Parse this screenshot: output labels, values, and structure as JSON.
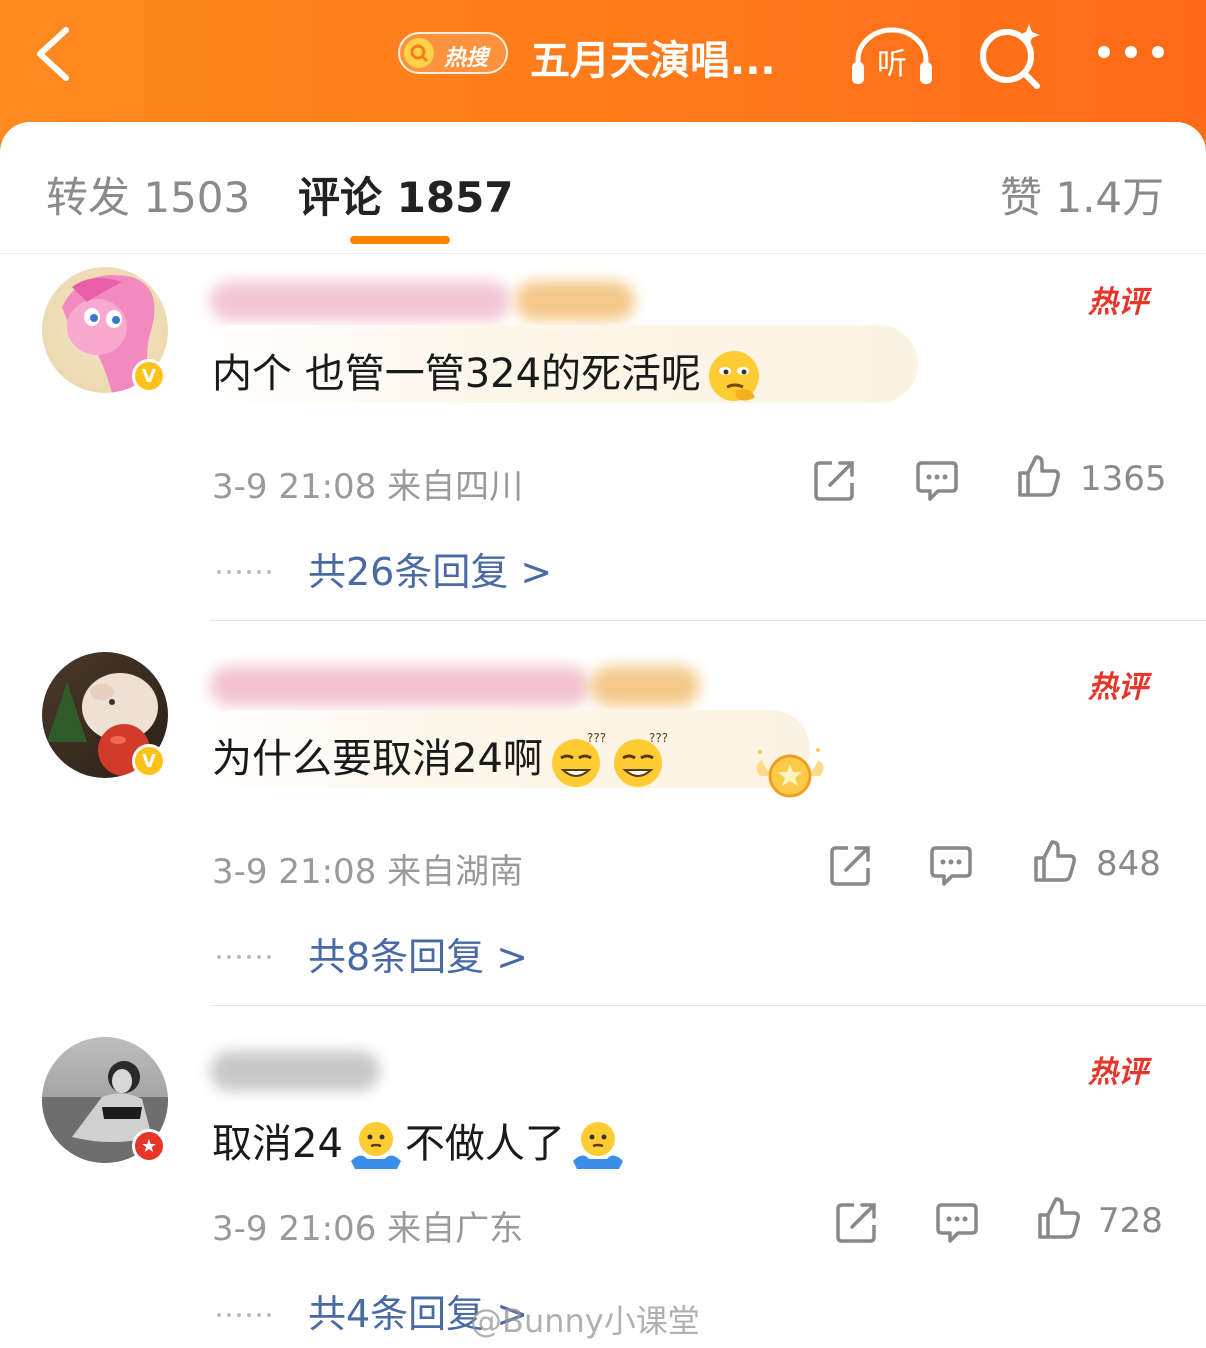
{
  "header": {
    "back_icon": "chevron-left-icon",
    "hot_search_label": "热搜",
    "title": "五月天演唱...",
    "listen_label": "听",
    "search_icon": "search-sparkle-icon",
    "more_icon": "more-dots-icon",
    "bg_color": "#ff7a1c"
  },
  "tabs": {
    "repost": "转发 1503",
    "comments": "评论 1857",
    "likes": "赞 1.4万",
    "active_color": "#ff8200"
  },
  "comments": [
    {
      "hot_tag": "热评",
      "text": "内个 也管一管324的死活呢",
      "emoji": "thinking-face-emoji",
      "time_location": "3-9 21:08  来自四川",
      "like_count": "1365",
      "replies": "共26条回复 >",
      "badge": "V"
    },
    {
      "hot_tag": "热评",
      "text": "为什么要取消24啊",
      "emoji": "confused-grin-emoji",
      "time_location": "3-9 21:08  来自湖南",
      "like_count": "848",
      "replies": "共8条回复 >",
      "badge": "V"
    },
    {
      "hot_tag": "热评",
      "text_part1": "取消24",
      "text_part2": "不做人了",
      "emoji": "shrug-emoji",
      "time_location": "3-9 21:06  来自广东",
      "like_count": "728",
      "replies": "共4条回复 >",
      "badge": "★"
    }
  ],
  "watermark": "@Bunny小课堂"
}
